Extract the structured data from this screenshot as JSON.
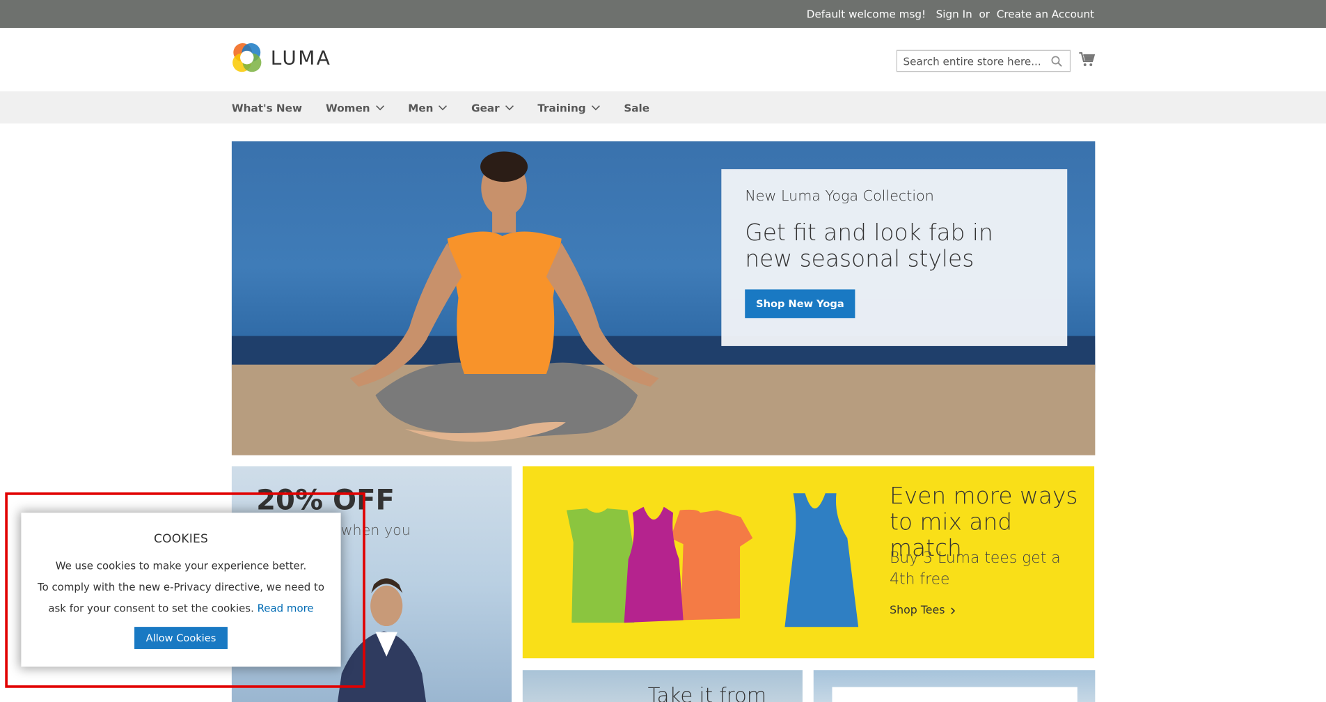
{
  "colors": {
    "top_panel": "#6e716e",
    "nav_bg": "#f0f0f0",
    "primary": "#1979c3",
    "promo_yellow": "#f9df18",
    "highlight": "#e10000"
  },
  "header_panel": {
    "welcome": "Default welcome msg!",
    "sign_in": "Sign In",
    "or": "or",
    "create_account": "Create an Account"
  },
  "logo": {
    "text": "LUMA"
  },
  "search": {
    "placeholder": "Search entire store here..."
  },
  "nav": {
    "items": [
      {
        "label": "What's New",
        "has_dropdown": false
      },
      {
        "label": "Women",
        "has_dropdown": true
      },
      {
        "label": "Men",
        "has_dropdown": true
      },
      {
        "label": "Gear",
        "has_dropdown": true
      },
      {
        "label": "Training",
        "has_dropdown": true
      },
      {
        "label": "Sale",
        "has_dropdown": false
      }
    ]
  },
  "hero": {
    "subtitle": "New Luma Yoga Collection",
    "title": "Get fit and look fab in new seasonal styles",
    "button": "Shop New Yoga"
  },
  "promo_left": {
    "headline": "20% OFF",
    "subline": "when you"
  },
  "promo_right": {
    "title": "Even more ways to mix and match",
    "text": "Buy 3 Luma tees get a 4th free",
    "link": "Shop Tees"
  },
  "tile_a": {
    "title": "Take it from"
  },
  "cookie": {
    "title": "COOKIES",
    "line1": "We use cookies to make your experience better.",
    "line2": "To comply with the new e-Privacy directive, we need to",
    "line3": "ask for your consent to set the cookies.",
    "read_more": "Read more",
    "allow": "Allow Cookies"
  }
}
